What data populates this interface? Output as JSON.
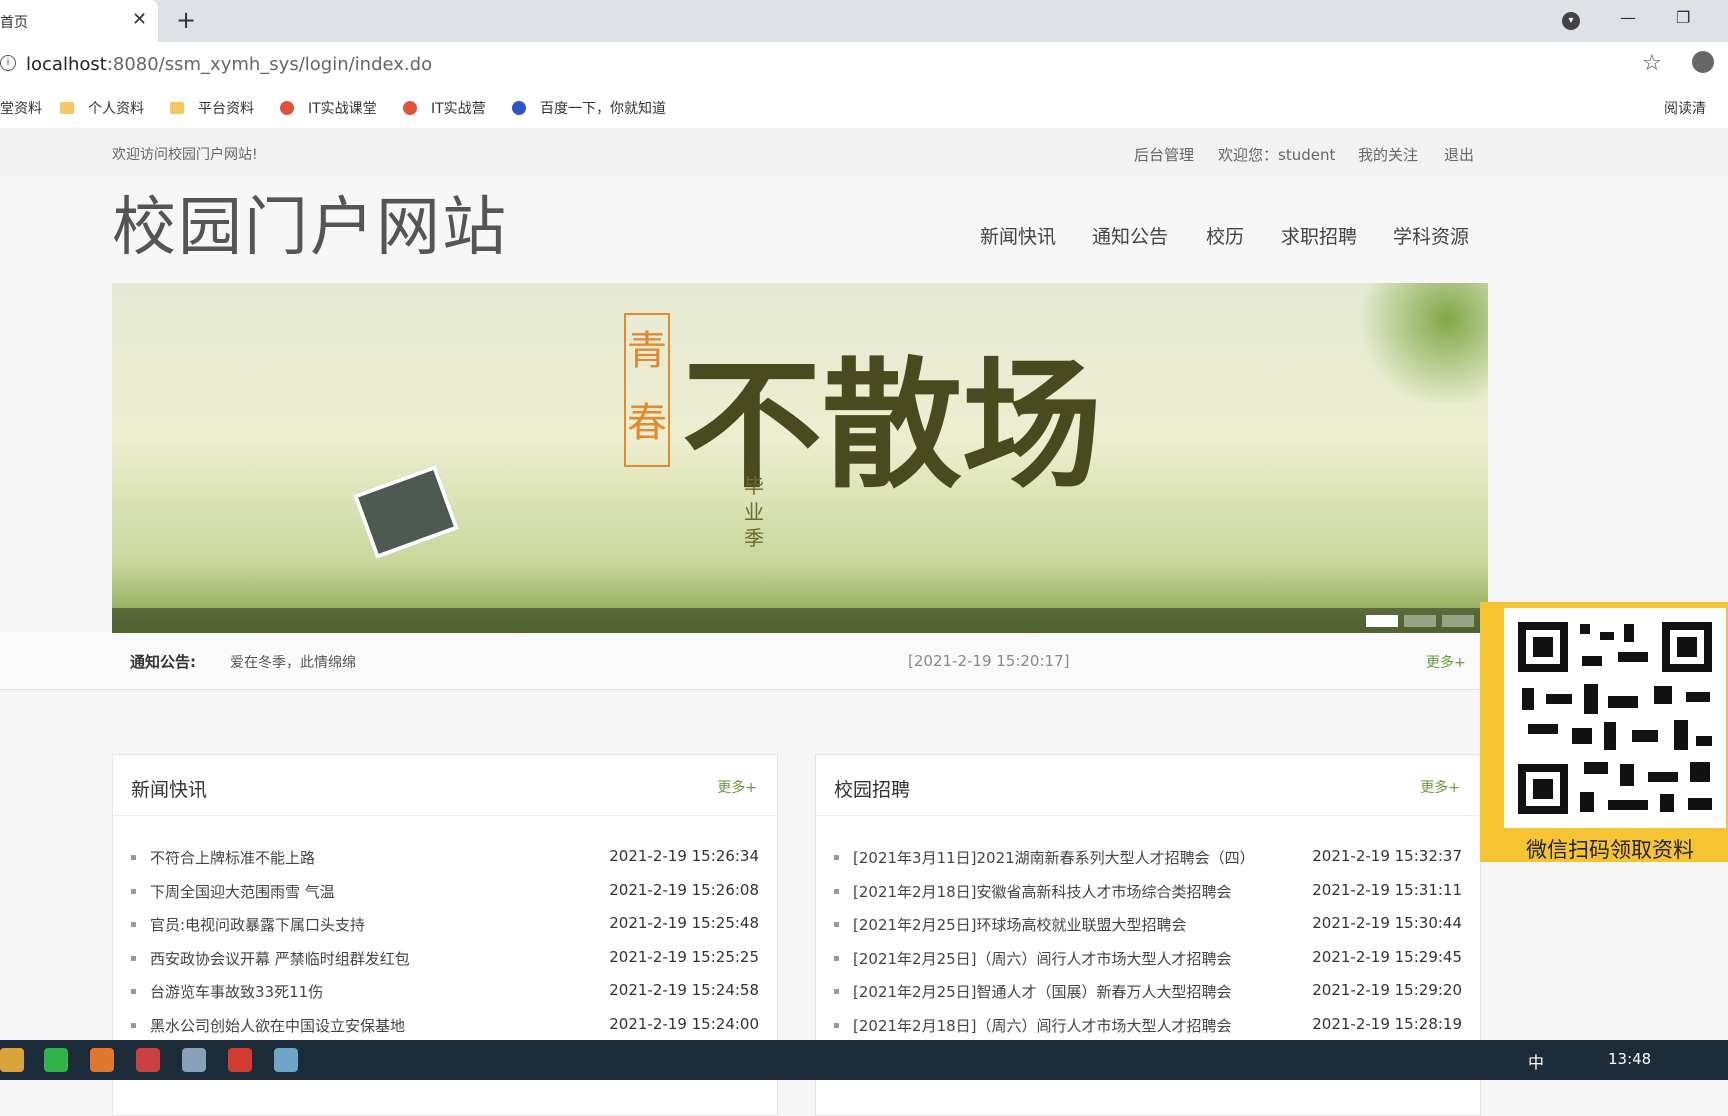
{
  "browser": {
    "tab_title": "首页",
    "url_host": "localhost",
    "url_rest": ":8080/ssm_xymh_sys/login/index.do",
    "bookmarks": [
      "堂资料",
      "个人资料",
      "平台资料",
      "IT实战课堂",
      "IT实战营",
      "百度一下，你就知道"
    ],
    "reading_mode": "阅读清"
  },
  "site": {
    "welcome": "欢迎访问校园门户网站!",
    "admin_link": "后台管理",
    "user_greeting": "欢迎您：student",
    "my_follow": "我的关注",
    "logout": "退出",
    "title": "校园门户网站",
    "nav": [
      "新闻快讯",
      "通知公告",
      "校历",
      "求职招聘",
      "学科资源"
    ]
  },
  "banner": {
    "text_qing": "青春",
    "text_big": "不散场",
    "text_season": "毕业季",
    "slide_count": 3,
    "active_slide": 1
  },
  "notice": {
    "label": "通知公告:",
    "text": "爱在冬季，此情绵绵",
    "time": "[2021-2-19 15:20:17]",
    "more": "更多+"
  },
  "news": {
    "title": "新闻快讯",
    "more": "更多+",
    "items": [
      {
        "text": "不符合上牌标准不能上路",
        "date": "2021-2-19 15:26:34"
      },
      {
        "text": "下周全国迎大范围雨雪 气温",
        "date": "2021-2-19 15:26:08"
      },
      {
        "text": "官员:电视问政暴露下属口头支持",
        "date": "2021-2-19 15:25:48"
      },
      {
        "text": "西安政协会议开幕 严禁临时组群发红包",
        "date": "2021-2-19 15:25:25"
      },
      {
        "text": "台游览车事故致33死11伤",
        "date": "2021-2-19 15:24:58"
      },
      {
        "text": "黑水公司创始人欲在中国设立安保基地",
        "date": "2021-2-19 15:24:00"
      }
    ]
  },
  "jobs": {
    "title": "校园招聘",
    "more": "更多+",
    "items": [
      {
        "text": "[2021年3月11日]2021湖南新春系列大型人才招聘会（四）",
        "date": "2021-2-19 15:32:37"
      },
      {
        "text": "[2021年2月18日]安徽省高新科技人才市场综合类招聘会",
        "date": "2021-2-19 15:31:11"
      },
      {
        "text": "[2021年2月25日]环球场高校就业联盟大型招聘会",
        "date": "2021-2-19 15:30:44"
      },
      {
        "text": "[2021年2月25日]（周六）闾行人才市场大型人才招聘会",
        "date": "2021-2-19 15:29:45"
      },
      {
        "text": "[2021年2月25日]智通人才（国展）新春万人大型招聘会",
        "date": "2021-2-19 15:29:20"
      },
      {
        "text": "[2021年2月18日]（周六）闾行人才市场大型人才招聘会",
        "date": "2021-2-19 15:28:19"
      }
    ]
  },
  "qr": {
    "caption": "微信扫码领取资料"
  },
  "taskbar": {
    "time": "13:48",
    "ime": "中"
  }
}
